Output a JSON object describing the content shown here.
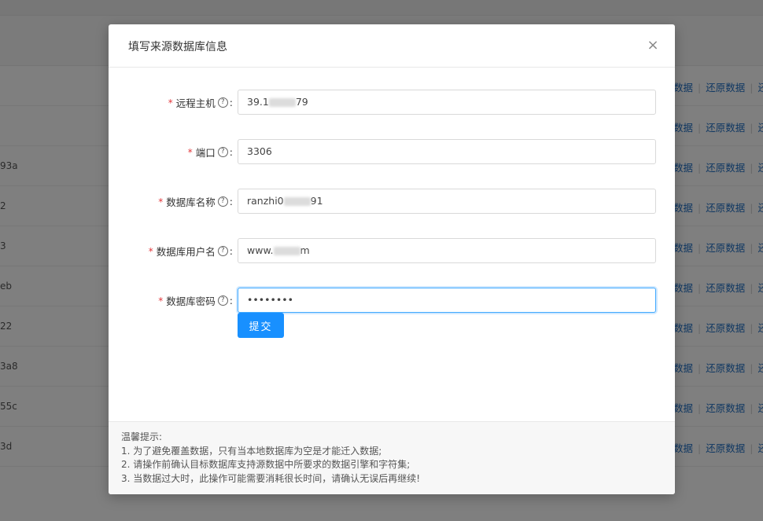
{
  "background": {
    "rows": [
      {
        "id": "",
        "actions": [
          "数据",
          "还原数据",
          "还"
        ]
      },
      {
        "id": "",
        "actions": [
          "数据",
          "还原数据",
          "还"
        ]
      },
      {
        "id": "93a",
        "actions": [
          "数据",
          "还原数据",
          "还"
        ]
      },
      {
        "id": "2",
        "actions": [
          "数据",
          "还原数据",
          "还"
        ]
      },
      {
        "id": "3",
        "actions": [
          "数据",
          "还原数据",
          "还"
        ]
      },
      {
        "id": "eb",
        "actions": [
          "数据",
          "还原数据",
          "还"
        ]
      },
      {
        "id": "22",
        "actions": [
          "数据",
          "还原数据",
          "还"
        ]
      },
      {
        "id": "3a8",
        "actions": [
          "数据",
          "还原数据",
          "还"
        ]
      },
      {
        "id": "55c",
        "actions": [
          "数据",
          "还原数据",
          "还"
        ]
      },
      {
        "id": "3d",
        "actions": [
          "数据",
          "还原数据",
          "还"
        ]
      }
    ]
  },
  "modal": {
    "title": "填写来源数据库信息",
    "close_glyph": "×",
    "fields": [
      {
        "label": "远程主机",
        "value_prefix": "39.1",
        "value_suffix": "79",
        "redacted": true
      },
      {
        "label": "端口",
        "value_prefix": "3306",
        "value_suffix": "",
        "redacted": false
      },
      {
        "label": "数据库名称",
        "value_prefix": "ranzhi0",
        "value_suffix": "91",
        "redacted": true
      },
      {
        "label": "数据库用户名",
        "value_prefix": "www.",
        "value_suffix": "m",
        "redacted": true
      },
      {
        "label": "数据库密码",
        "value_prefix": "••••••••",
        "value_suffix": "",
        "redacted": false
      }
    ],
    "help_glyph": "?",
    "required_mark": "*",
    "colon": ":",
    "submit_label": "提交",
    "tips": [
      "温馨提示:",
      "1. 为了避免覆盖数据，只有当本地数据库为空是才能迁入数据;",
      "2. 请操作前确认目标数据库支持源数据中所要求的数据引擎和字符集;",
      "3. 当数据过大时，此操作可能需要消耗很长时间，请确认无误后再继续!"
    ]
  },
  "colors": {
    "primary": "#1890ff",
    "required": "#e2363a",
    "link": "#1f6fc5"
  }
}
